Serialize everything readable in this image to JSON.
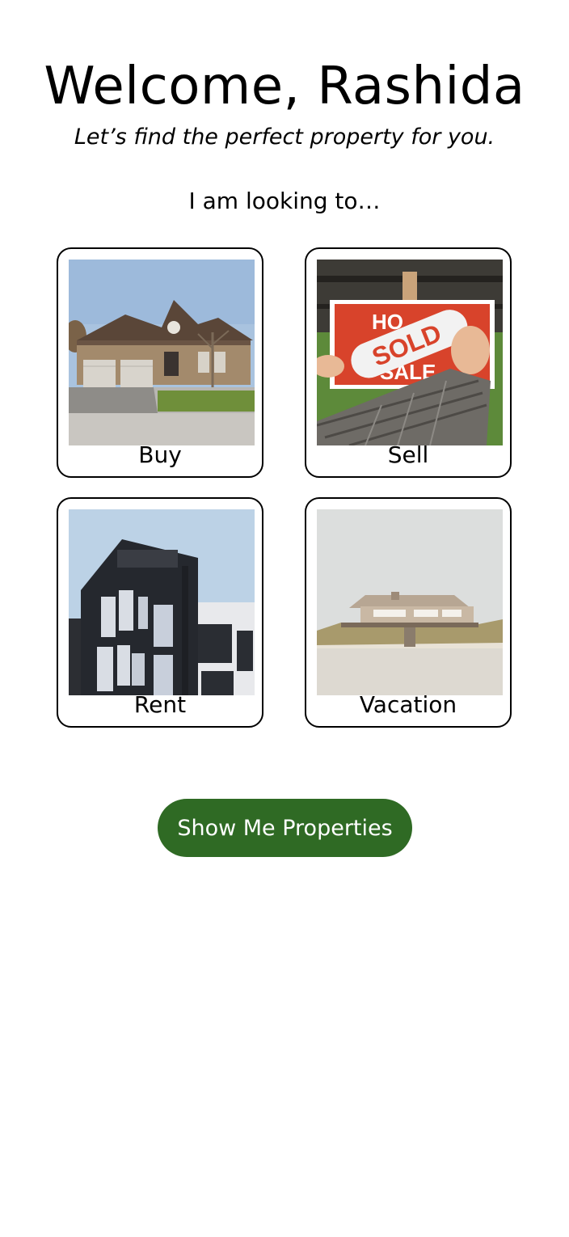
{
  "header": {
    "title": "Welcome, Rashida",
    "subtitle": "Let’s find the perfect property for you.",
    "prompt": "I am looking to…"
  },
  "options": [
    {
      "label": "Buy",
      "image": "suburban-house-photo"
    },
    {
      "label": "Sell",
      "image": "sold-sign-photo"
    },
    {
      "label": "Rent",
      "image": "modern-apartment-building-photo"
    },
    {
      "label": "Vacation",
      "image": "beach-house-photo"
    }
  ],
  "sign": {
    "top": "HO",
    "sold": "SOLD",
    "bottom": "SALE"
  },
  "cta": {
    "label": "Show Me Properties"
  },
  "colors": {
    "accent": "#2f6a24",
    "sign_red": "#d8432b"
  }
}
